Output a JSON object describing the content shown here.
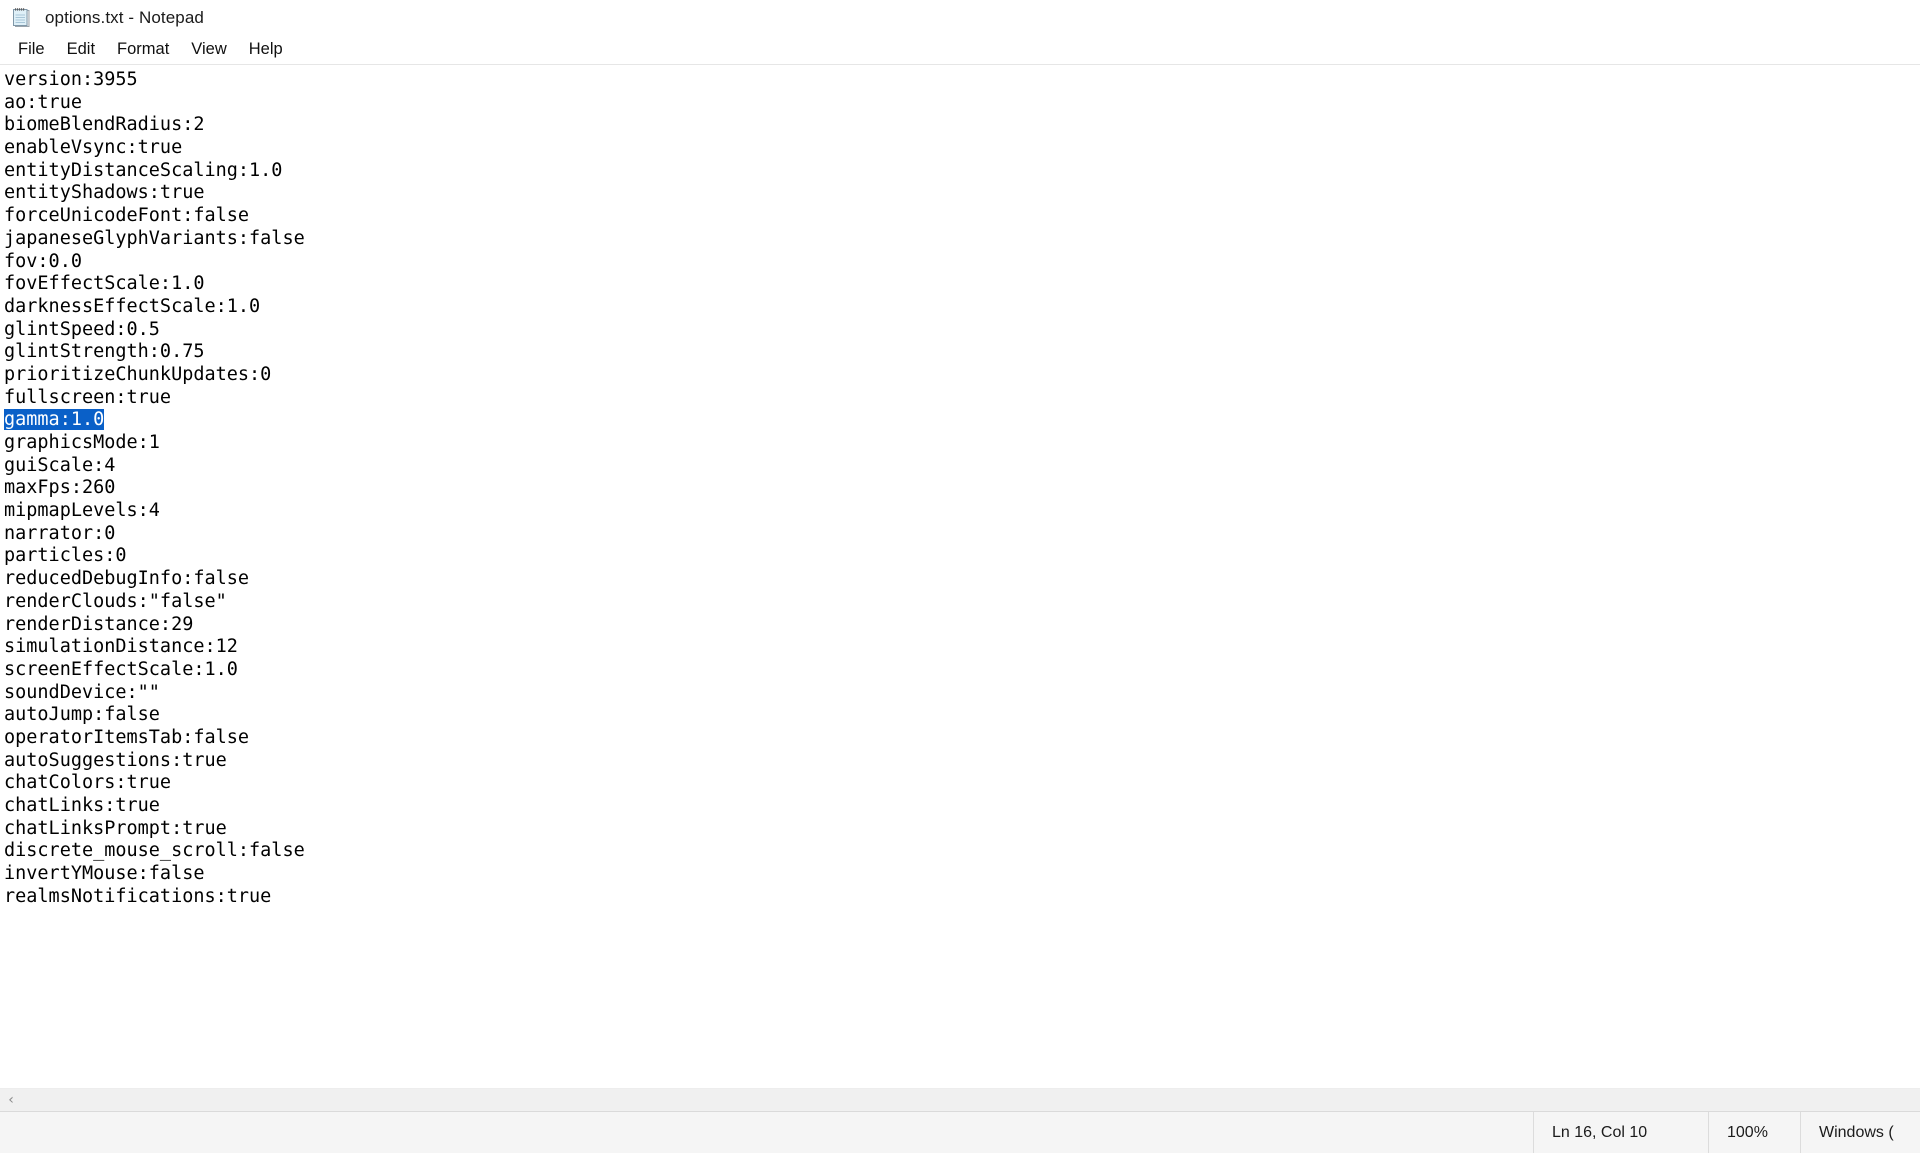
{
  "window": {
    "title": "options.txt - Notepad",
    "icon": "notepad-icon"
  },
  "menu": {
    "items": [
      {
        "label": "File"
      },
      {
        "label": "Edit"
      },
      {
        "label": "Format"
      },
      {
        "label": "View"
      },
      {
        "label": "Help"
      }
    ]
  },
  "editor": {
    "selection": {
      "line_index": 15,
      "text": "gamma:1.0",
      "background_color": "#0a60c8",
      "text_color": "#ffffff"
    },
    "lines": [
      "version:3955",
      "ao:true",
      "biomeBlendRadius:2",
      "enableVsync:true",
      "entityDistanceScaling:1.0",
      "entityShadows:true",
      "forceUnicodeFont:false",
      "japaneseGlyphVariants:false",
      "fov:0.0",
      "fovEffectScale:1.0",
      "darknessEffectScale:1.0",
      "glintSpeed:0.5",
      "glintStrength:0.75",
      "prioritizeChunkUpdates:0",
      "fullscreen:true",
      "gamma:1.0",
      "graphicsMode:1",
      "guiScale:4",
      "maxFps:260",
      "mipmapLevels:4",
      "narrator:0",
      "particles:0",
      "reducedDebugInfo:false",
      "renderClouds:\"false\"",
      "renderDistance:29",
      "simulationDistance:12",
      "screenEffectScale:1.0",
      "soundDevice:\"\"",
      "autoJump:false",
      "operatorItemsTab:false",
      "autoSuggestions:true",
      "chatColors:true",
      "chatLinks:true",
      "chatLinksPrompt:true",
      "discrete_mouse_scroll:false",
      "invertYMouse:false",
      "realmsNotifications:true"
    ]
  },
  "scrollbar": {
    "left_arrow": "‹",
    "right_arrow": "›"
  },
  "status_bar": {
    "line_column": "Ln 16, Col 10",
    "zoom": "100%",
    "line_ending": "Windows ("
  }
}
